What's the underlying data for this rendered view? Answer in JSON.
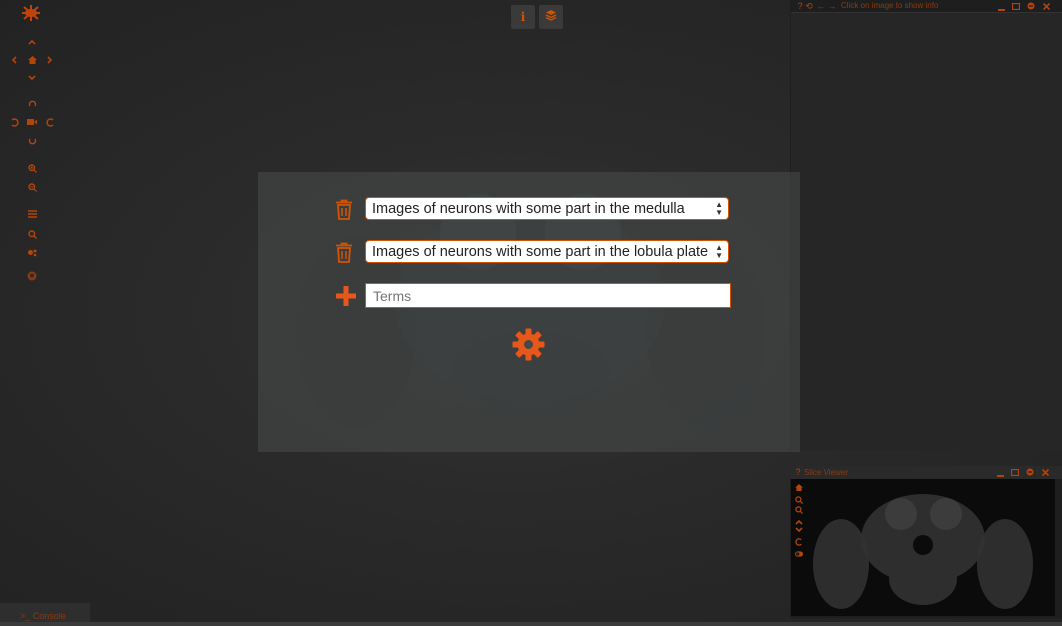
{
  "query": {
    "filters": [
      {
        "label": "Images of neurons with some part in the medulla"
      },
      {
        "label": "Images of neurons with some part in the lobula plate"
      }
    ],
    "terms_placeholder": "Terms"
  },
  "info_panel": {
    "title": "Click on image to show info"
  },
  "slice_viewer": {
    "title": "Slice Viewer"
  },
  "console": {
    "label": "Console"
  },
  "icons": {
    "left_toolbar": [
      "pan-up-icon",
      "pan-left-icon",
      "home-icon",
      "pan-right-icon",
      "pan-down-icon",
      "rotate-up-icon",
      "rotate-left-icon",
      "camera-icon",
      "rotate-right-icon",
      "rotate-down-icon",
      "zoom-in-icon",
      "zoom-out-icon",
      "list-icon",
      "search-icon",
      "query-icon",
      "github-icon"
    ],
    "top": [
      "info-icon",
      "layers-icon"
    ]
  },
  "colors": {
    "accent": "#d35400",
    "background": "#2b2b2b"
  }
}
